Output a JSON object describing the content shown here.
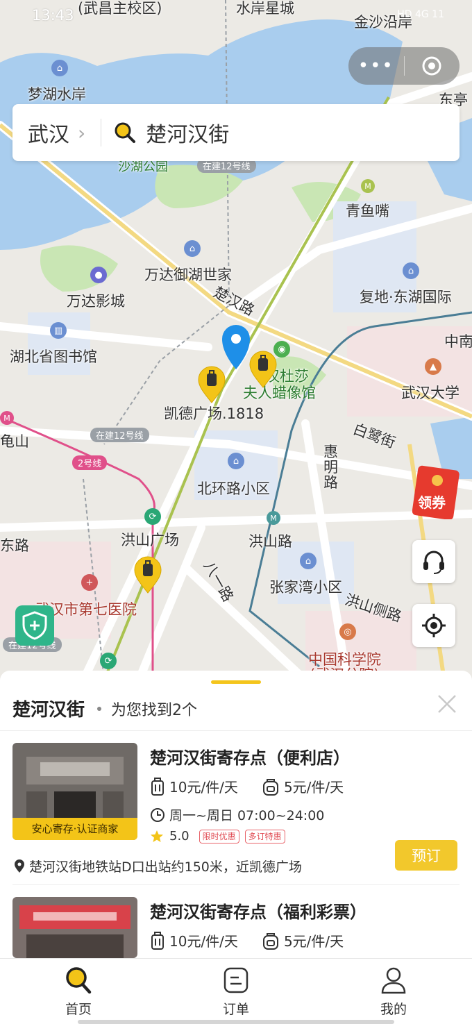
{
  "status_bar": {
    "time": "13:43",
    "right_text": "HD 4G 11"
  },
  "search": {
    "city": "武汉",
    "query": "楚河汉街"
  },
  "map": {
    "labels": [
      {
        "text": "(武昌主校区)",
        "cls": ""
      },
      {
        "text": "水岸星城",
        "cls": ""
      },
      {
        "text": "金沙沿岸",
        "cls": ""
      },
      {
        "text": "梦湖水岸",
        "cls": ""
      },
      {
        "text": "东亭",
        "cls": ""
      },
      {
        "text": "沙湖公园",
        "cls": "green"
      },
      {
        "text": "青鱼嘴",
        "cls": ""
      },
      {
        "text": "万达御湖世家",
        "cls": ""
      },
      {
        "text": "万达影城",
        "cls": ""
      },
      {
        "text": "楚汉路",
        "cls": ""
      },
      {
        "text": "复地·东湖国际",
        "cls": ""
      },
      {
        "text": "湖北省图书馆",
        "cls": ""
      },
      {
        "text": "汉杜莎",
        "cls": "green"
      },
      {
        "text": "夫人蜡像馆",
        "cls": "green"
      },
      {
        "text": "中南",
        "cls": ""
      },
      {
        "text": "武汉大学",
        "cls": ""
      },
      {
        "text": "凯德广场.1818",
        "cls": ""
      },
      {
        "text": "龟山",
        "cls": ""
      },
      {
        "text": "白鹭街",
        "cls": ""
      },
      {
        "text": "惠明路",
        "cls": ""
      },
      {
        "text": "北环路小区",
        "cls": ""
      },
      {
        "text": "洪山广场",
        "cls": ""
      },
      {
        "text": "洪山路",
        "cls": ""
      },
      {
        "text": "张家湾小区",
        "cls": ""
      },
      {
        "text": "洪山侧路",
        "cls": ""
      },
      {
        "text": "武汉市第七医院",
        "cls": "red"
      },
      {
        "text": "中国科学院",
        "cls": "red"
      },
      {
        "text": "(武汉分院)",
        "cls": "red"
      },
      {
        "text": "八一路",
        "cls": ""
      },
      {
        "text": "东路",
        "cls": ""
      }
    ],
    "line_badges": [
      "在建12号线",
      "在建12号线",
      "2号线",
      "在建12号线"
    ],
    "coupon_label": "领券"
  },
  "results": {
    "title": "楚河汉街",
    "count_text": "为您找到2个",
    "stores": [
      {
        "name": "楚河汉街寄存点（便利店）",
        "price_large": "10元/件/天",
        "price_small": "5元/件/天",
        "hours": "周一~周日 07:00~24:00",
        "rating": "5.0",
        "promos": [
          "限时优惠",
          "多订特惠"
        ],
        "badge": "安心寄存·认证商家",
        "address": "楚河汉街地铁站D口出站约150米，近凯德广场",
        "book_label": "预订"
      },
      {
        "name": "楚河汉街寄存点（福利彩票）",
        "price_large": "10元/件/天",
        "price_small": "5元/件/天"
      }
    ]
  },
  "tabbar": {
    "tabs": [
      {
        "label": "首页"
      },
      {
        "label": "订单"
      },
      {
        "label": "我的"
      }
    ]
  },
  "colors": {
    "accent": "#f3c418",
    "water": "#a9cdee",
    "park": "#c9e6b4",
    "road": "#ffffff",
    "metro_line": "#a9c24f"
  }
}
